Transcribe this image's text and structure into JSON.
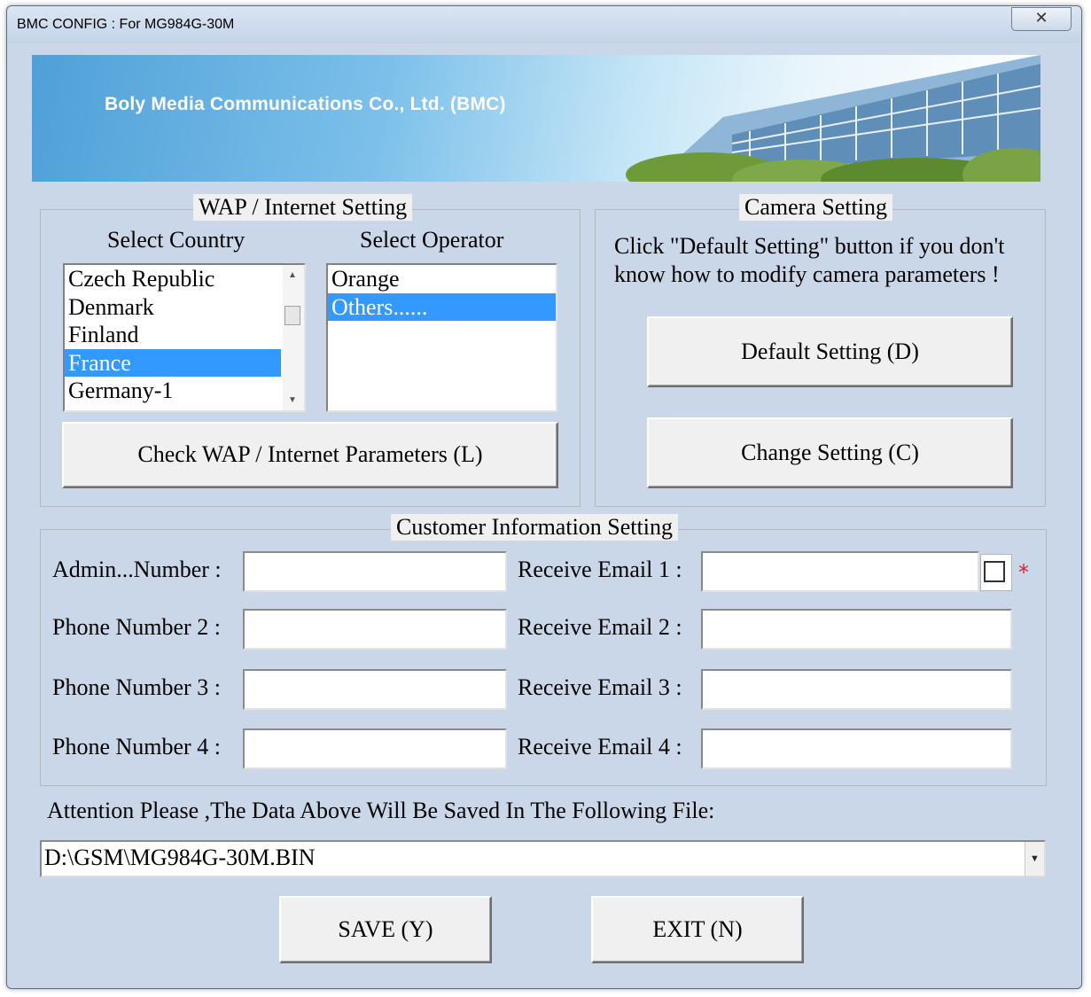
{
  "window": {
    "title": "BMC CONFIG : For MG984G-30M",
    "close_icon": "close-icon"
  },
  "banner": {
    "text": "Boly Media Communications Co., Ltd. (BMC)"
  },
  "wap": {
    "legend": "WAP / Internet Setting",
    "country_label": "Select Country",
    "operator_label": "Select Operator",
    "countries": [
      "Czech Republic",
      "Denmark",
      "Finland",
      "France",
      "Germany-1"
    ],
    "selected_country": "France",
    "operators": [
      "Orange",
      "Others......"
    ],
    "selected_operator": "Others......",
    "check_button": "Check WAP / Internet Parameters (L)"
  },
  "camera": {
    "legend": "Camera Setting",
    "hint_line1": "Click \"Default Setting\" button if you don't",
    "hint_line2": "know how to modify camera parameters !",
    "default_button": "Default Setting (D)",
    "change_button": "Change Setting (C)"
  },
  "customer": {
    "legend": "Customer Information Setting",
    "phone_labels": [
      "Admin...Number :",
      "Phone Number 2 :",
      "Phone Number 3 :",
      "Phone Number 4 :"
    ],
    "phone_values": [
      "",
      "",
      "",
      ""
    ],
    "email_labels": [
      "Receive Email 1 :",
      "Receive Email 2 :",
      "Receive Email 3 :",
      "Receive Email 4 :"
    ],
    "email_values": [
      "",
      "",
      "",
      ""
    ],
    "required_mark": "*"
  },
  "file": {
    "attention": "Attention Please ,The Data Above Will Be Saved In The Following  File:",
    "path": "D:\\GSM\\MG984G-30M.BIN"
  },
  "actions": {
    "save": "SAVE (Y)",
    "exit": "EXIT (N)"
  }
}
